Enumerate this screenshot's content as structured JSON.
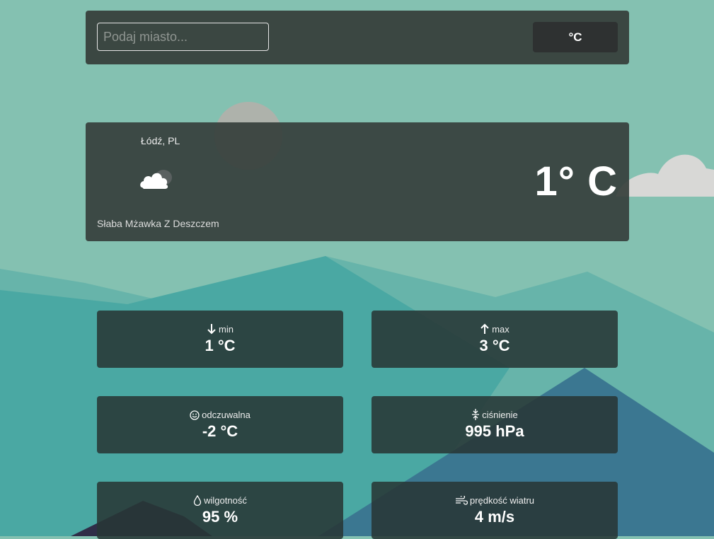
{
  "search": {
    "placeholder": "Podaj miasto..."
  },
  "unit_toggle": {
    "label": "°C"
  },
  "current": {
    "city": "Łódź, PL",
    "condition_icon": "cloud-icon",
    "description": "Słaba Mżawka Z Deszczem",
    "temperature": "1° C"
  },
  "details": [
    {
      "icon": "arrow-down-icon",
      "label": "min",
      "value": "1 °C"
    },
    {
      "icon": "arrow-up-icon",
      "label": "max",
      "value": "3 °C"
    },
    {
      "icon": "smiley-icon",
      "label": "odczuwalna",
      "value": "-2 °C"
    },
    {
      "icon": "pressure-icon",
      "label": "ciśnienie",
      "value": "995 hPa"
    },
    {
      "icon": "droplet-icon",
      "label": "wilgotność",
      "value": "95 %"
    },
    {
      "icon": "wind-icon",
      "label": "prędkość wiatru",
      "value": "4 m/s"
    }
  ]
}
